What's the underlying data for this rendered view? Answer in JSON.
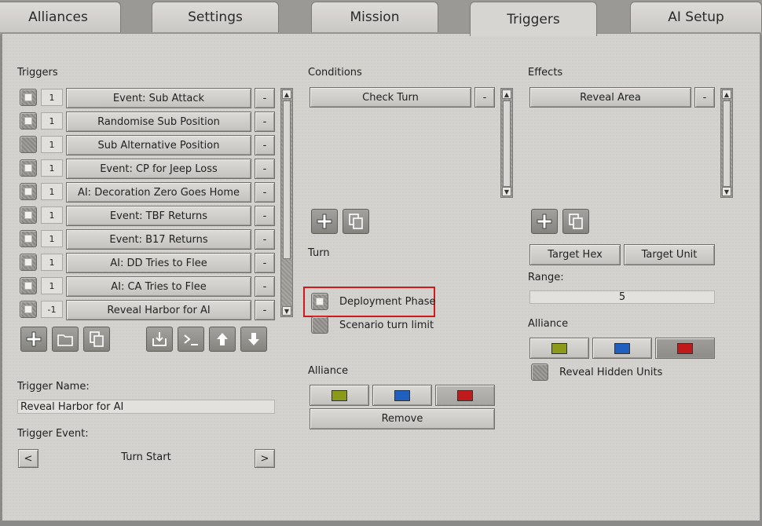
{
  "tabs": [
    "Alliances",
    "Settings",
    "Mission",
    "Triggers",
    "AI Setup"
  ],
  "triggers": {
    "label": "Triggers",
    "items": [
      {
        "checked": true,
        "priority": "1",
        "name": "Event: Sub Attack"
      },
      {
        "checked": true,
        "priority": "1",
        "name": "Randomise Sub Position"
      },
      {
        "checked": false,
        "priority": "1",
        "name": "Sub Alternative Position"
      },
      {
        "checked": true,
        "priority": "1",
        "name": "Event: CP for Jeep Loss"
      },
      {
        "checked": true,
        "priority": "1",
        "name": "AI: Decoration Zero Goes Home"
      },
      {
        "checked": true,
        "priority": "1",
        "name": "Event: TBF Returns"
      },
      {
        "checked": true,
        "priority": "1",
        "name": "Event: B17 Returns"
      },
      {
        "checked": true,
        "priority": "1",
        "name": "AI: DD Tries to Flee"
      },
      {
        "checked": true,
        "priority": "1",
        "name": "AI: CA Tries to Flee"
      },
      {
        "checked": true,
        "priority": "-1",
        "name": "Reveal Harbor for AI"
      }
    ],
    "remove_label": "-",
    "tool_icons": [
      "add-icon",
      "folder-icon",
      "copy-icon",
      "import-icon",
      "console-icon",
      "arrow-up-icon",
      "arrow-down-icon"
    ],
    "name_label": "Trigger Name:",
    "name_value": "Reveal Harbor for AI",
    "event_label": "Trigger Event:",
    "event_value": "Turn Start",
    "prev": "<",
    "next": ">"
  },
  "conditions": {
    "label": "Conditions",
    "items": [
      "Check Turn"
    ],
    "remove_label": "-",
    "turn_label": "Turn",
    "deployment_phase": "Deployment Phase",
    "scenario_turn_limit": "Scenario turn limit",
    "alliance_label": "Alliance",
    "alliance_colors": [
      "#8c9a1a",
      "#1f5fc0",
      "#c01a1a"
    ],
    "remove_button": "Remove"
  },
  "effects": {
    "label": "Effects",
    "items": [
      "Reveal Area"
    ],
    "remove_label": "-",
    "target_hex": "Target Hex",
    "target_unit": "Target Unit",
    "range_label": "Range:",
    "range_value": "5",
    "alliance_label": "Alliance",
    "alliance_colors": [
      "#8c9a1a",
      "#1f5fc0",
      "#c01a1a"
    ],
    "reveal_hidden": "Reveal Hidden Units"
  }
}
